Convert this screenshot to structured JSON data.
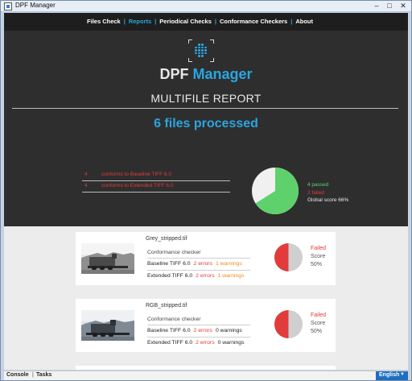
{
  "window": {
    "title": "DPF Manager"
  },
  "nav": {
    "items": [
      "Files Check",
      "Reports",
      "Periodical Checks",
      "Conformance Checkers",
      "About"
    ],
    "active_index": 1
  },
  "hero": {
    "brand_a": "DPF",
    "brand_b": "Manager",
    "report_title": "MULTIFILE REPORT",
    "files_processed": "6 files processed",
    "conformance_rows": [
      {
        "count": "4",
        "text": "conforms to Baseline TIFF 6.0"
      },
      {
        "count": "4",
        "text": "conforms to Extended TIFF 6.0"
      }
    ],
    "passed": "4 passed",
    "failed": "2 failed",
    "global_score": "Global score 66%",
    "passed_fraction": 0.66
  },
  "cards": [
    {
      "file_name": "Grey_stripped.tif",
      "checker_label": "Conformance checker",
      "rows": [
        {
          "name": "Baseline TIFF 6.0",
          "errors": "2 errors",
          "warnings": "1 warnings",
          "warn_color": "orange"
        },
        {
          "name": "Extended TIFF 6.0",
          "errors": "2 errors",
          "warnings": "1 warnings",
          "warn_color": "orange"
        }
      ],
      "status": "Failed",
      "score_label": "Score",
      "score": "50%",
      "score_fraction": 0.5
    },
    {
      "file_name": "RGB_stripped.tif",
      "checker_label": "Conformance checker",
      "rows": [
        {
          "name": "Baseline TIFF 6.0",
          "errors": "2 errors",
          "warnings": "0 warnings",
          "warn_color": "black"
        },
        {
          "name": "Extended TIFF 6.0",
          "errors": "2 errors",
          "warnings": "0 warnings",
          "warn_color": "black"
        }
      ],
      "status": "Failed",
      "score_label": "Score",
      "score": "50%",
      "score_fraction": 0.5
    }
  ],
  "bottom": {
    "console": "Console",
    "tasks": "Tasks",
    "language": "English"
  },
  "colors": {
    "accent": "#2aa6e0",
    "pass": "#5fd16c",
    "fail": "#e23b3b",
    "warn": "#f08c1a",
    "hero_bg": "#2e2e2e"
  }
}
